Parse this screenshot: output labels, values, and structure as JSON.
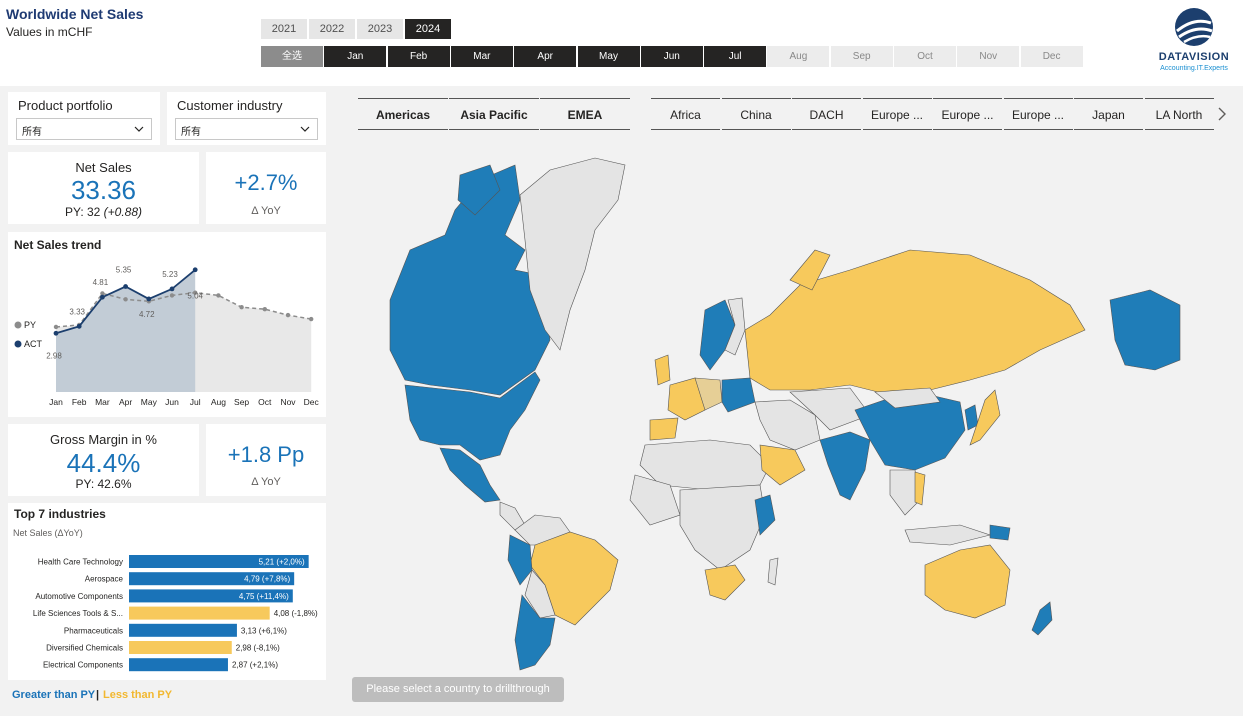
{
  "header": {
    "title": "Worldwide Net Sales",
    "subtitle": "Values in mCHF"
  },
  "years": [
    {
      "label": "2021",
      "active": false
    },
    {
      "label": "2022",
      "active": false
    },
    {
      "label": "2023",
      "active": false
    },
    {
      "label": "2024",
      "active": true
    }
  ],
  "months": [
    {
      "label": "全选",
      "state": "all"
    },
    {
      "label": "Jan",
      "state": "sel"
    },
    {
      "label": "Feb",
      "state": "sel"
    },
    {
      "label": "Mar",
      "state": "sel"
    },
    {
      "label": "Apr",
      "state": "sel"
    },
    {
      "label": "May",
      "state": "sel"
    },
    {
      "label": "Jun",
      "state": "sel"
    },
    {
      "label": "Jul",
      "state": "sel"
    },
    {
      "label": "Aug",
      "state": "unsel"
    },
    {
      "label": "Sep",
      "state": "unsel"
    },
    {
      "label": "Oct",
      "state": "unsel"
    },
    {
      "label": "Nov",
      "state": "unsel"
    },
    {
      "label": "Dec",
      "state": "unsel"
    }
  ],
  "logo": {
    "name": "DATAVISION",
    "tagline": "Accounting.IT.Experts"
  },
  "slicers": {
    "product": {
      "label": "Product portfolio",
      "value": "所有"
    },
    "customer": {
      "label": "Customer industry",
      "value": "所有"
    }
  },
  "net_sales": {
    "title": "Net Sales",
    "value": "33.36",
    "py_prefix": "PY: 32 ",
    "py_delta": "(+0.88)",
    "yoy_value": "+2.7%",
    "yoy_label": "Δ YoY"
  },
  "trend": {
    "title": "Net Sales trend",
    "legend_py": "PY",
    "legend_act": "ACT"
  },
  "gross_margin": {
    "title": "Gross Margin in %",
    "value": "44.4%",
    "py": "PY: 42.6%",
    "yoy_value": "+1.8 Pp",
    "yoy_label": "Δ YoY"
  },
  "industries": {
    "title": "Top 7 industries",
    "subtitle": "Net Sales (ΔYoY)"
  },
  "legend": {
    "greater": "Greater than PY",
    "separator": "|",
    "less": "Less than PY"
  },
  "regions_main": [
    "Americas",
    "Asia Pacific",
    "EMEA"
  ],
  "regions_sub": [
    "Africa",
    "China",
    "DACH",
    "Europe ...",
    "Europe ...",
    "Europe ...",
    "Japan",
    "LA North"
  ],
  "drill_button": "Please select a country to drillthrough",
  "colors": {
    "blue": "#1f7db8",
    "yellow": "#f7c95c",
    "tan": "#e6cf96",
    "gray": "#e4e4e4",
    "accent": "#1a73b8"
  },
  "chart_data": [
    {
      "type": "area",
      "title": "Net Sales trend",
      "categories": [
        "Jan",
        "Feb",
        "Mar",
        "Apr",
        "May",
        "Jun",
        "Jul",
        "Aug",
        "Sep",
        "Oct",
        "Nov",
        "Dec"
      ],
      "series": [
        {
          "name": "ACT",
          "values": [
            2.98,
            3.33,
            4.81,
            5.35,
            4.72,
            5.23,
            6.2
          ]
        },
        {
          "name": "PY",
          "values": [
            3.3,
            3.4,
            5.0,
            4.7,
            4.6,
            4.9,
            5.04,
            4.9,
            4.3,
            4.2,
            3.9,
            3.7
          ]
        }
      ],
      "data_labels": [
        {
          "index": 0,
          "text": "2.98"
        },
        {
          "index": 1,
          "text": "3.33"
        },
        {
          "index": 2,
          "text": "4.81"
        },
        {
          "index": 3,
          "text": "5.35"
        },
        {
          "index": 4,
          "text": "4.72"
        },
        {
          "index": 5,
          "text": "5.23"
        },
        {
          "index": 6,
          "text": "5.04"
        }
      ],
      "ylim": [
        0,
        7
      ],
      "grid": false,
      "legend": "left"
    },
    {
      "type": "bar",
      "title": "Top 7 industries",
      "categories": [
        "Health Care Technology",
        "Aerospace",
        "Automotive Components",
        "Life Sciences Tools & S...",
        "Pharmaceuticals",
        "Diversified Chemicals",
        "Electrical Components"
      ],
      "values": [
        5.21,
        4.79,
        4.75,
        4.08,
        3.13,
        2.98,
        2.87
      ],
      "labels": [
        "5,21 (+2,0%)",
        "4,79 (+7,8%)",
        "4,75 (+11,4%)",
        "4,08 (-1,8%)",
        "3,13 (+6,1%)",
        "2,98 (-8,1%)",
        "2,87 (+2,1%)"
      ],
      "status": [
        "greater",
        "greater",
        "greater",
        "less",
        "greater",
        "less",
        "greater"
      ],
      "xlim": [
        0,
        5.8
      ]
    }
  ]
}
